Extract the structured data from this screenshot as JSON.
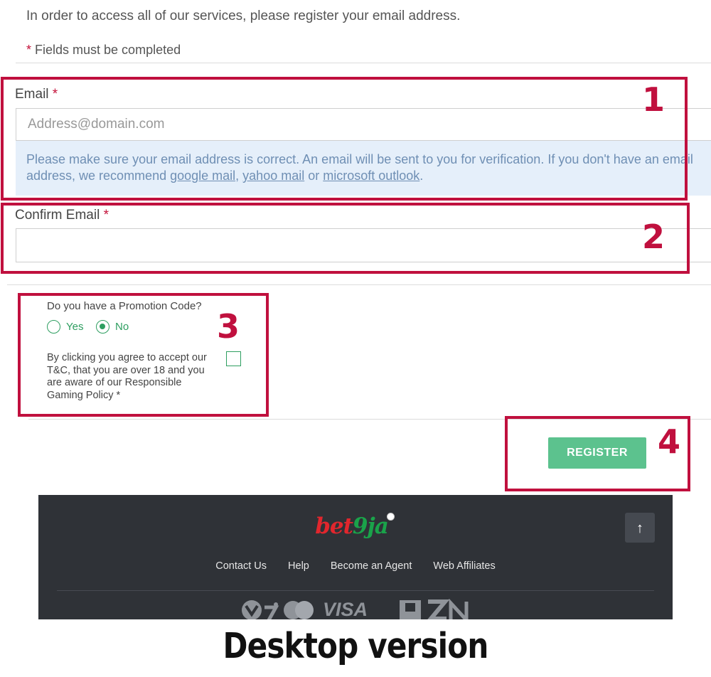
{
  "intro": "In order to access all of our services, please register your email address.",
  "required_note": {
    "star": "*",
    "text": " Fields must be completed"
  },
  "email": {
    "label": "Email",
    "star": "*",
    "placeholder": "Address@domain.com",
    "value": "",
    "info_text_1": "Please make sure your email address is correct. An email will be sent to you for verification. If you don't have an email",
    "info_text_2": "address, we recommend ",
    "link_google": "google mail",
    "sep_1": ", ",
    "link_yahoo": "yahoo mail",
    "sep_2": " or ",
    "link_outlook": "microsoft outlook",
    "end": "."
  },
  "confirm_email": {
    "label": "Confirm Email",
    "star": "*",
    "value": ""
  },
  "promo": {
    "question": "Do you have a Promotion Code?",
    "yes_label": "Yes",
    "no_label": "No",
    "selected": "No"
  },
  "terms": {
    "text": "By clicking you agree to accept our T&C, that you are over 18 and you are aware of our Responsible Gaming Policy *",
    "checked": false
  },
  "register_label": "REGISTER",
  "annotations": [
    "1",
    "2",
    "3",
    "4"
  ],
  "footer": {
    "logo_bet": "bet",
    "logo_nine": "9ja",
    "to_top_icon": "arrow-up-icon",
    "to_top": "↑",
    "links": [
      "Contact Us",
      "Help",
      "Become an Agent",
      "Web Affiliates"
    ],
    "payment_visa": "VISA"
  },
  "caption": "Desktop version",
  "colors": {
    "accent_red": "#c0103e",
    "green": "#5cc28e",
    "radio_green": "#2e9e60",
    "footer_bg": "#2f3237",
    "info_bg": "#e5effa"
  }
}
